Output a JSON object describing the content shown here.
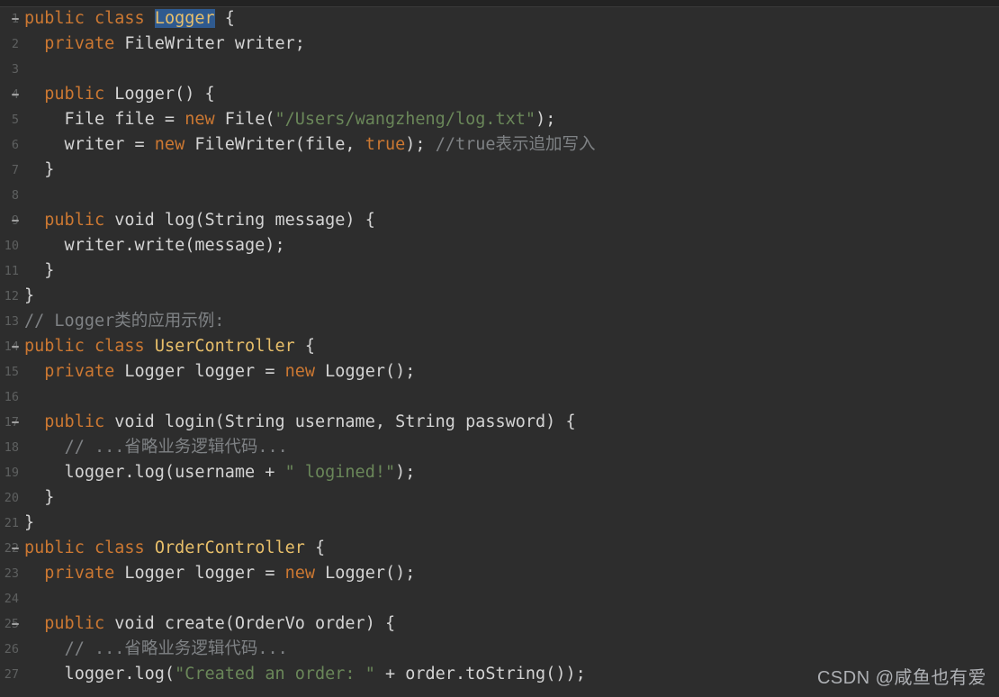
{
  "editor": {
    "theme_name": "darcula",
    "background_color": "#2d2d2d",
    "gutter_color": "#5e6060",
    "colors": {
      "keyword": "#cc7832",
      "plain_text": "#d4d4d4",
      "string": "#6a8759",
      "comment": "#7f8285",
      "class_name": "#e8bf6a",
      "selection_background": "#2f5a8f"
    },
    "language": "Java",
    "selected_text": "Logger"
  },
  "lines": [
    {
      "number": "1",
      "fold": true,
      "tokens": [
        {
          "t": "public",
          "c": "kw"
        },
        {
          "t": " ",
          "c": "plain"
        },
        {
          "t": "class",
          "c": "kw"
        },
        {
          "t": " ",
          "c": "plain"
        },
        {
          "t": "Logger",
          "c": "sel"
        },
        {
          "t": " {",
          "c": "plain"
        }
      ]
    },
    {
      "number": "2",
      "fold": false,
      "tokens": [
        {
          "t": "  ",
          "c": "plain"
        },
        {
          "t": "private",
          "c": "kw"
        },
        {
          "t": " FileWriter writer;",
          "c": "plain"
        }
      ]
    },
    {
      "number": "3",
      "fold": false,
      "tokens": []
    },
    {
      "number": "4",
      "fold": true,
      "tokens": [
        {
          "t": "  ",
          "c": "plain"
        },
        {
          "t": "public",
          "c": "kw"
        },
        {
          "t": " Logger() {",
          "c": "plain"
        }
      ]
    },
    {
      "number": "5",
      "fold": false,
      "tokens": [
        {
          "t": "    File file = ",
          "c": "plain"
        },
        {
          "t": "new",
          "c": "kw"
        },
        {
          "t": " File(",
          "c": "plain"
        },
        {
          "t": "\"/Users/wangzheng/log.txt\"",
          "c": "str"
        },
        {
          "t": ");",
          "c": "plain"
        }
      ]
    },
    {
      "number": "6",
      "fold": false,
      "tokens": [
        {
          "t": "    writer = ",
          "c": "plain"
        },
        {
          "t": "new",
          "c": "kw"
        },
        {
          "t": " FileWriter(file, ",
          "c": "plain"
        },
        {
          "t": "true",
          "c": "kw"
        },
        {
          "t": "); ",
          "c": "plain"
        },
        {
          "t": "//true表示追加写入",
          "c": "cmt"
        }
      ]
    },
    {
      "number": "7",
      "fold": false,
      "tokens": [
        {
          "t": "  }",
          "c": "plain"
        }
      ]
    },
    {
      "number": "8",
      "fold": false,
      "tokens": []
    },
    {
      "number": "9",
      "fold": true,
      "tokens": [
        {
          "t": "  ",
          "c": "plain"
        },
        {
          "t": "public",
          "c": "kw"
        },
        {
          "t": " void log(String message) {",
          "c": "plain"
        }
      ]
    },
    {
      "number": "10",
      "fold": false,
      "tokens": [
        {
          "t": "    writer.write(message);",
          "c": "plain"
        }
      ]
    },
    {
      "number": "11",
      "fold": false,
      "tokens": [
        {
          "t": "  }",
          "c": "plain"
        }
      ]
    },
    {
      "number": "12",
      "fold": false,
      "tokens": [
        {
          "t": "}",
          "c": "plain"
        }
      ]
    },
    {
      "number": "13",
      "fold": false,
      "tokens": [
        {
          "t": "// Logger类的应用示例:",
          "c": "cmt"
        }
      ]
    },
    {
      "number": "14",
      "fold": true,
      "tokens": [
        {
          "t": "public",
          "c": "kw"
        },
        {
          "t": " ",
          "c": "plain"
        },
        {
          "t": "class",
          "c": "kw"
        },
        {
          "t": " ",
          "c": "plain"
        },
        {
          "t": "UserController",
          "c": "cls"
        },
        {
          "t": " {",
          "c": "plain"
        }
      ]
    },
    {
      "number": "15",
      "fold": false,
      "tokens": [
        {
          "t": "  ",
          "c": "plain"
        },
        {
          "t": "private",
          "c": "kw"
        },
        {
          "t": " Logger logger = ",
          "c": "plain"
        },
        {
          "t": "new",
          "c": "kw"
        },
        {
          "t": " Logger();",
          "c": "plain"
        }
      ]
    },
    {
      "number": "16",
      "fold": false,
      "tokens": []
    },
    {
      "number": "17",
      "fold": true,
      "tokens": [
        {
          "t": "  ",
          "c": "plain"
        },
        {
          "t": "public",
          "c": "kw"
        },
        {
          "t": " void login(String username, String password) {",
          "c": "plain"
        }
      ]
    },
    {
      "number": "18",
      "fold": false,
      "tokens": [
        {
          "t": "    ",
          "c": "plain"
        },
        {
          "t": "// ...省略业务逻辑代码...",
          "c": "cmt"
        }
      ]
    },
    {
      "number": "19",
      "fold": false,
      "tokens": [
        {
          "t": "    logger.log(username + ",
          "c": "plain"
        },
        {
          "t": "\" logined!\"",
          "c": "str"
        },
        {
          "t": ");",
          "c": "plain"
        }
      ]
    },
    {
      "number": "20",
      "fold": false,
      "tokens": [
        {
          "t": "  }",
          "c": "plain"
        }
      ]
    },
    {
      "number": "21",
      "fold": false,
      "tokens": [
        {
          "t": "}",
          "c": "plain"
        }
      ]
    },
    {
      "number": "22",
      "fold": true,
      "tokens": [
        {
          "t": "public",
          "c": "kw"
        },
        {
          "t": " ",
          "c": "plain"
        },
        {
          "t": "class",
          "c": "kw"
        },
        {
          "t": " ",
          "c": "plain"
        },
        {
          "t": "OrderController",
          "c": "cls"
        },
        {
          "t": " {",
          "c": "plain"
        }
      ]
    },
    {
      "number": "23",
      "fold": false,
      "tokens": [
        {
          "t": "  ",
          "c": "plain"
        },
        {
          "t": "private",
          "c": "kw"
        },
        {
          "t": " Logger logger = ",
          "c": "plain"
        },
        {
          "t": "new",
          "c": "kw"
        },
        {
          "t": " Logger();",
          "c": "plain"
        }
      ]
    },
    {
      "number": "24",
      "fold": false,
      "tokens": []
    },
    {
      "number": "25",
      "fold": true,
      "tokens": [
        {
          "t": "  ",
          "c": "plain"
        },
        {
          "t": "public",
          "c": "kw"
        },
        {
          "t": " void create(OrderVo order) {",
          "c": "plain"
        }
      ]
    },
    {
      "number": "26",
      "fold": false,
      "tokens": [
        {
          "t": "    ",
          "c": "plain"
        },
        {
          "t": "// ...省略业务逻辑代码...",
          "c": "cmt"
        }
      ]
    },
    {
      "number": "27",
      "fold": false,
      "tokens": [
        {
          "t": "    logger.log(",
          "c": "plain"
        },
        {
          "t": "\"Created an order: \"",
          "c": "str"
        },
        {
          "t": " + order.toString());",
          "c": "plain"
        }
      ]
    }
  ],
  "watermark": {
    "text": "CSDN @咸鱼也有爱"
  }
}
